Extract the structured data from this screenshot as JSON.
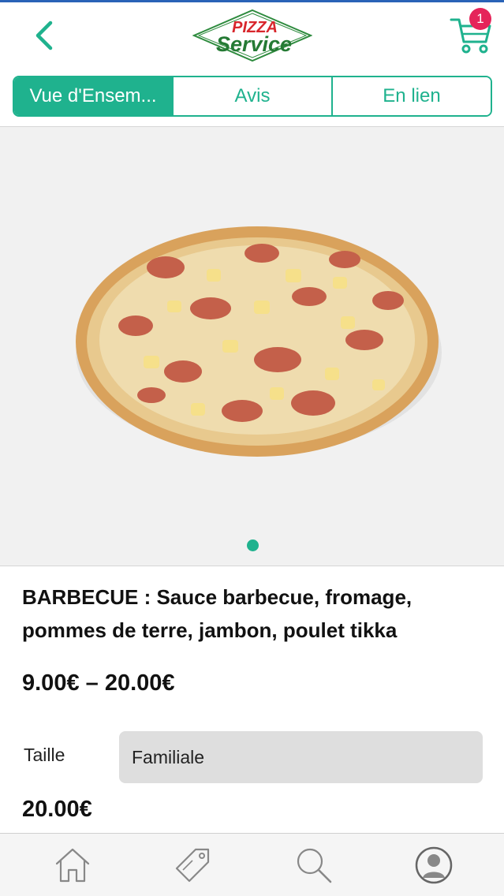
{
  "header": {
    "back_icon": "chevron-left-icon",
    "logo_line1": "PIZZA",
    "logo_line2": "Service",
    "cart_icon": "cart-icon",
    "cart_count": "1"
  },
  "tabs": [
    {
      "label": "Vue d'Ensem...",
      "active": true
    },
    {
      "label": "Avis",
      "active": false
    },
    {
      "label": "En lien",
      "active": false
    }
  ],
  "product": {
    "description": "BARBECUE : Sauce barbecue, fromage, pommes de terre, jambon, poulet tikka",
    "price_range": "9.00€ – 20.00€",
    "size_label": "Taille",
    "size_value": "Familiale",
    "price": "20.00€"
  },
  "gallery": {
    "current_page": 1,
    "total_pages": 1
  },
  "bottom_nav": [
    {
      "icon": "home-icon"
    },
    {
      "icon": "tag-icon"
    },
    {
      "icon": "search-icon"
    },
    {
      "icon": "user-icon"
    }
  ],
  "colors": {
    "accent": "#1fb28e",
    "badge": "#e5245a",
    "top_line": "#2a63b7"
  }
}
